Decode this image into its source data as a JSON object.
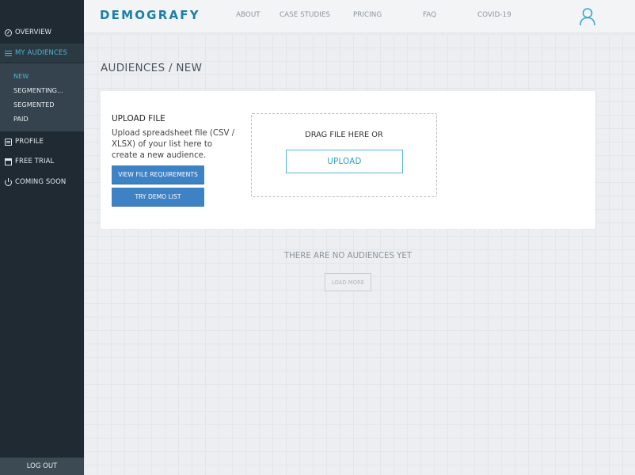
{
  "sidebar": {
    "items": [
      {
        "label": "OVERVIEW",
        "icon": "overview-icon"
      },
      {
        "label": "MY AUDIENCES",
        "icon": "audiences-icon"
      },
      {
        "label": "PROFILE",
        "icon": "profile-icon"
      },
      {
        "label": "FREE TRIAL",
        "icon": "gift-icon"
      },
      {
        "label": "COMING SOON",
        "icon": "power-icon"
      }
    ],
    "subitems": [
      {
        "label": "NEW"
      },
      {
        "label": "SEGMENTING..."
      },
      {
        "label": "SEGMENTED"
      },
      {
        "label": "PAID"
      }
    ],
    "logout_label": "LOG OUT"
  },
  "header": {
    "logo": "DEMOGRAFY",
    "nav": [
      {
        "label": "ABOUT"
      },
      {
        "label": "CASE STUDIES"
      },
      {
        "label": "PRICING"
      },
      {
        "label": "FAQ"
      },
      {
        "label": "COVID-19"
      }
    ],
    "user_icon": "user-icon"
  },
  "main": {
    "title": "AUDIENCES / NEW",
    "upload": {
      "title": "UPLOAD FILE",
      "description": "Upload spreadsheet file (CSV / XLSX) of your list here to create a new audience.",
      "requirements_label": "VIEW FILE REQUIREMENTS",
      "demo_label": "TRY DEMO LIST",
      "drag_text": "DRAG FILE HERE OR",
      "upload_label": "UPLOAD"
    },
    "empty_message": "THERE ARE NO AUDIENCES YET",
    "load_more_label": "LOAD MORE"
  },
  "colors": {
    "sidebar_bg": "#1f2a33",
    "accent": "#4fb3d6",
    "brand": "#1c7fa6",
    "button_blue": "#3e82c6"
  }
}
